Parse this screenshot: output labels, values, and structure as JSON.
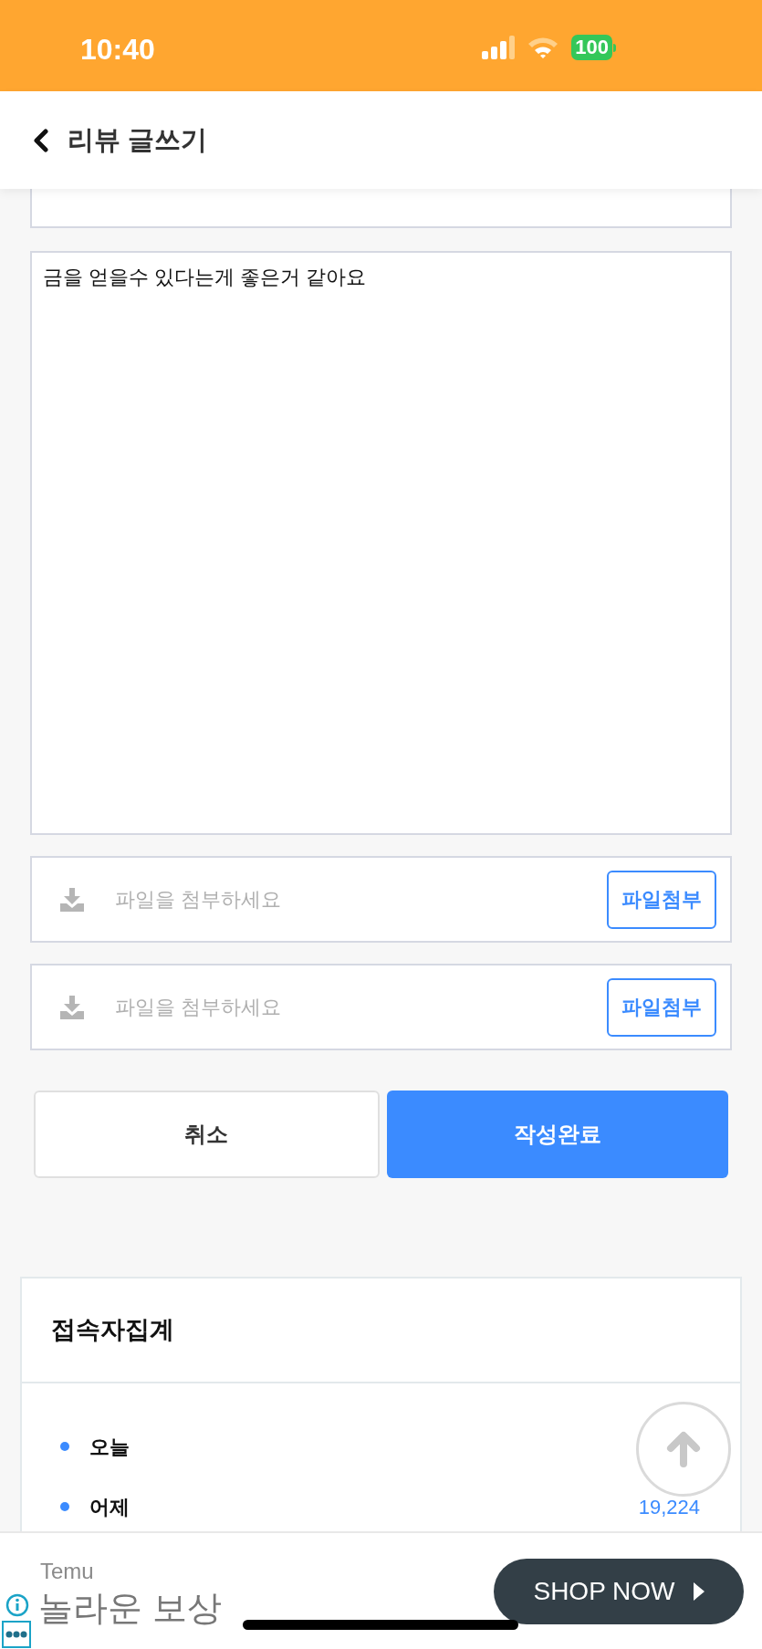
{
  "status_bar": {
    "time": "10:40",
    "battery": "100"
  },
  "header": {
    "title": "리뷰 글쓰기"
  },
  "form": {
    "content": "금을 얻을수 있다는게 좋은거 같아요",
    "attachments": [
      {
        "placeholder": "파일을 첨부하세요",
        "button": "파일첨부"
      },
      {
        "placeholder": "파일을 첨부하세요",
        "button": "파일첨부"
      }
    ],
    "buttons": [
      {
        "label": "취소",
        "kind": "secondary"
      },
      {
        "label": "작성완료",
        "kind": "primary"
      }
    ]
  },
  "visitors": {
    "title": "접속자집계",
    "items": [
      {
        "label": "오늘"
      },
      {
        "label": "어제",
        "value": "19,224"
      }
    ]
  },
  "ad": {
    "brand": "Temu",
    "headline": "놀라운 보상",
    "cta": "SHOP NOW"
  }
}
